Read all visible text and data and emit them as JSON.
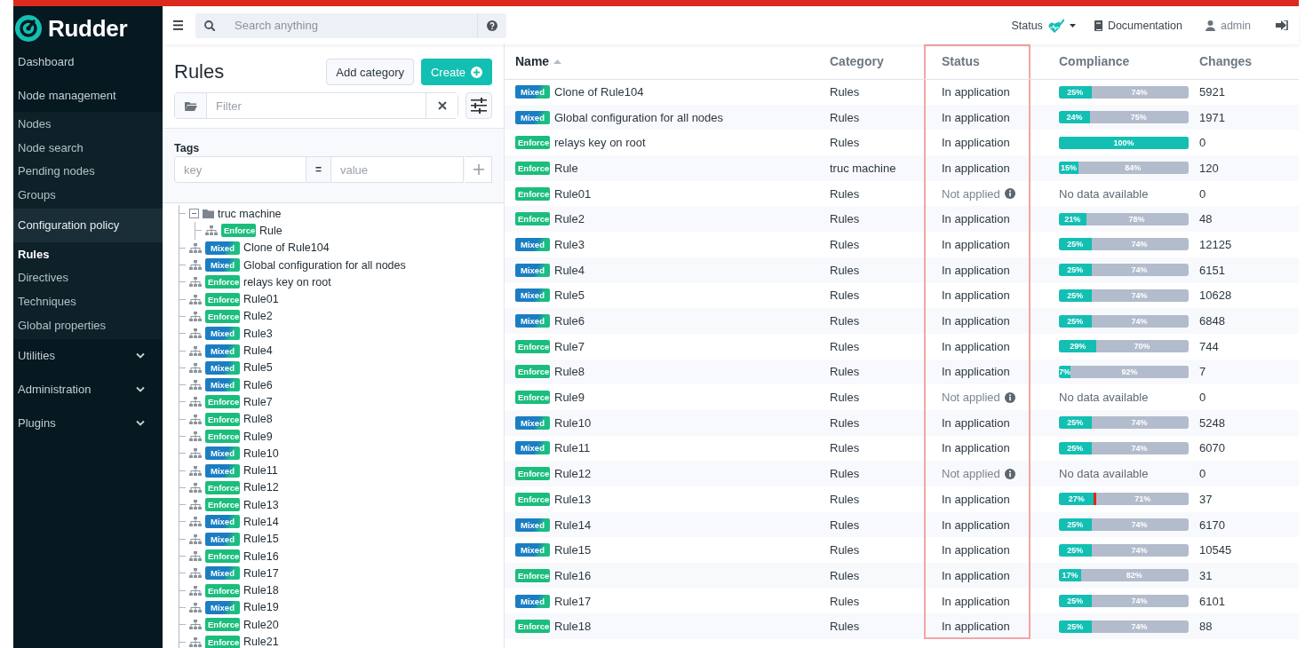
{
  "topbar": {
    "search": {
      "placeholder": "Search anything"
    },
    "status_label": "Status",
    "documentation": "Documentation",
    "user": "admin"
  },
  "sidebar": {
    "logo": "Rudder",
    "sections": [
      {
        "label": "Dashboard",
        "kind": "link",
        "selected": false
      },
      {
        "label": "Node management",
        "kind": "group",
        "selected": false,
        "expanded": true,
        "items": [
          {
            "label": "Nodes",
            "selected": false
          },
          {
            "label": "Node search",
            "selected": false
          },
          {
            "label": "Pending nodes",
            "selected": false
          },
          {
            "label": "Groups",
            "selected": false
          }
        ]
      },
      {
        "label": "Configuration policy",
        "kind": "group",
        "selected": true,
        "expanded": true,
        "items": [
          {
            "label": "Rules",
            "selected": true
          },
          {
            "label": "Directives",
            "selected": false
          },
          {
            "label": "Techniques",
            "selected": false
          },
          {
            "label": "Global properties",
            "selected": false
          }
        ]
      },
      {
        "label": "Utilities",
        "kind": "group",
        "selected": false,
        "expanded": false
      },
      {
        "label": "Administration",
        "kind": "group",
        "selected": false,
        "expanded": false
      },
      {
        "label": "Plugins",
        "kind": "group",
        "selected": false,
        "expanded": false
      }
    ]
  },
  "rules_panel": {
    "title": "Rules",
    "add_category": "Add category",
    "create": "Create",
    "filter": {
      "placeholder": "Filter"
    },
    "tags": {
      "label": "Tags",
      "key_placeholder": "key",
      "operator": "=",
      "value_placeholder": "value"
    },
    "tree": [
      {
        "kind": "folder",
        "label": "truc machine",
        "expanded": true,
        "children": [
          {
            "kind": "rule",
            "mode": {
              "kind": "enforce",
              "label": "Enforce"
            },
            "label": "Rule"
          }
        ]
      },
      {
        "kind": "rule",
        "mode": {
          "kind": "mixed",
          "label": "Mixed"
        },
        "label": "Clone of Rule104"
      },
      {
        "kind": "rule",
        "mode": {
          "kind": "mixed",
          "label": "Mixed"
        },
        "label": "Global configuration for all nodes"
      },
      {
        "kind": "rule",
        "mode": {
          "kind": "enforce",
          "label": "Enforce"
        },
        "label": "relays key on root"
      },
      {
        "kind": "rule",
        "mode": {
          "kind": "enforce",
          "label": "Enforce"
        },
        "label": "Rule01"
      },
      {
        "kind": "rule",
        "mode": {
          "kind": "enforce",
          "label": "Enforce"
        },
        "label": "Rule2"
      },
      {
        "kind": "rule",
        "mode": {
          "kind": "mixed",
          "label": "Mixed"
        },
        "label": "Rule3"
      },
      {
        "kind": "rule",
        "mode": {
          "kind": "mixed",
          "label": "Mixed"
        },
        "label": "Rule4"
      },
      {
        "kind": "rule",
        "mode": {
          "kind": "mixed",
          "label": "Mixed"
        },
        "label": "Rule5"
      },
      {
        "kind": "rule",
        "mode": {
          "kind": "mixed",
          "label": "Mixed"
        },
        "label": "Rule6"
      },
      {
        "kind": "rule",
        "mode": {
          "kind": "enforce",
          "label": "Enforce"
        },
        "label": "Rule7"
      },
      {
        "kind": "rule",
        "mode": {
          "kind": "enforce",
          "label": "Enforce"
        },
        "label": "Rule8"
      },
      {
        "kind": "rule",
        "mode": {
          "kind": "enforce",
          "label": "Enforce"
        },
        "label": "Rule9"
      },
      {
        "kind": "rule",
        "mode": {
          "kind": "mixed",
          "label": "Mixed"
        },
        "label": "Rule10"
      },
      {
        "kind": "rule",
        "mode": {
          "kind": "mixed",
          "label": "Mixed"
        },
        "label": "Rule11"
      },
      {
        "kind": "rule",
        "mode": {
          "kind": "enforce",
          "label": "Enforce"
        },
        "label": "Rule12"
      },
      {
        "kind": "rule",
        "mode": {
          "kind": "enforce",
          "label": "Enforce"
        },
        "label": "Rule13"
      },
      {
        "kind": "rule",
        "mode": {
          "kind": "mixed",
          "label": "Mixed"
        },
        "label": "Rule14"
      },
      {
        "kind": "rule",
        "mode": {
          "kind": "mixed",
          "label": "Mixed"
        },
        "label": "Rule15"
      },
      {
        "kind": "rule",
        "mode": {
          "kind": "enforce",
          "label": "Enforce"
        },
        "label": "Rule16"
      },
      {
        "kind": "rule",
        "mode": {
          "kind": "mixed",
          "label": "Mixed"
        },
        "label": "Rule17"
      },
      {
        "kind": "rule",
        "mode": {
          "kind": "enforce",
          "label": "Enforce"
        },
        "label": "Rule18"
      },
      {
        "kind": "rule",
        "mode": {
          "kind": "mixed",
          "label": "Mixed"
        },
        "label": "Rule19"
      },
      {
        "kind": "rule",
        "mode": {
          "kind": "enforce",
          "label": "Enforce"
        },
        "label": "Rule20"
      },
      {
        "kind": "rule",
        "mode": {
          "kind": "enforce",
          "label": "Enforce"
        },
        "label": "Rule21"
      }
    ]
  },
  "table": {
    "columns": [
      {
        "label": "Name",
        "sorted": true
      },
      {
        "label": "Category",
        "sorted": false
      },
      {
        "label": "Status",
        "sorted": false
      },
      {
        "label": "Compliance",
        "sorted": false
      },
      {
        "label": "Changes",
        "sorted": false
      }
    ],
    "rows": [
      {
        "mode": {
          "kind": "mixed",
          "label": "Mixed"
        },
        "name": "Clone of Rule104",
        "category": "Rules",
        "status": {
          "kind": "applied",
          "text": "In application"
        },
        "compliance": {
          "kind": "bar",
          "segments": [
            {
              "kind": "success",
              "label": "25%",
              "level": 0.25
            },
            {
              "kind": "pending",
              "label": "74%",
              "level": 0.74
            }
          ]
        },
        "changes": "5921"
      },
      {
        "mode": {
          "kind": "mixed",
          "label": "Mixed"
        },
        "name": "Global configuration for all nodes",
        "category": "Rules",
        "status": {
          "kind": "applied",
          "text": "In application"
        },
        "compliance": {
          "kind": "bar",
          "segments": [
            {
              "kind": "success",
              "label": "24%",
              "level": 0.24
            },
            {
              "kind": "pending",
              "label": "75%",
              "level": 0.75
            }
          ]
        },
        "changes": "1971"
      },
      {
        "mode": {
          "kind": "enforce",
          "label": "Enforce"
        },
        "name": "relays key on root",
        "category": "Rules",
        "status": {
          "kind": "applied",
          "text": "In application"
        },
        "compliance": {
          "kind": "bar",
          "segments": [
            {
              "kind": "success",
              "label": "100%",
              "level": 1
            }
          ]
        },
        "changes": "0"
      },
      {
        "mode": {
          "kind": "enforce",
          "label": "Enforce"
        },
        "name": "Rule",
        "category": "truc machine",
        "status": {
          "kind": "applied",
          "text": "In application"
        },
        "compliance": {
          "kind": "bar",
          "segments": [
            {
              "kind": "success",
              "label": "15%",
              "level": 0.15
            },
            {
              "kind": "pending",
              "label": "84%",
              "level": 0.84
            }
          ]
        },
        "changes": "120"
      },
      {
        "mode": {
          "kind": "enforce",
          "label": "Enforce"
        },
        "name": "Rule01",
        "category": "Rules",
        "status": {
          "kind": "not_applied",
          "text": "Not applied"
        },
        "compliance": {
          "kind": "none",
          "text": "No data available"
        },
        "changes": "0"
      },
      {
        "mode": {
          "kind": "enforce",
          "label": "Enforce"
        },
        "name": "Rule2",
        "category": "Rules",
        "status": {
          "kind": "applied",
          "text": "In application"
        },
        "compliance": {
          "kind": "bar",
          "segments": [
            {
              "kind": "success",
              "label": "21%",
              "level": 0.21
            },
            {
              "kind": "pending",
              "label": "78%",
              "level": 0.78
            }
          ]
        },
        "changes": "48"
      },
      {
        "mode": {
          "kind": "mixed",
          "label": "Mixed"
        },
        "name": "Rule3",
        "category": "Rules",
        "status": {
          "kind": "applied",
          "text": "In application"
        },
        "compliance": {
          "kind": "bar",
          "segments": [
            {
              "kind": "success",
              "label": "25%",
              "level": 0.25
            },
            {
              "kind": "pending",
              "label": "74%",
              "level": 0.74
            }
          ]
        },
        "changes": "12125"
      },
      {
        "mode": {
          "kind": "mixed",
          "label": "Mixed"
        },
        "name": "Rule4",
        "category": "Rules",
        "status": {
          "kind": "applied",
          "text": "In application"
        },
        "compliance": {
          "kind": "bar",
          "segments": [
            {
              "kind": "success",
              "label": "25%",
              "level": 0.25
            },
            {
              "kind": "pending",
              "label": "74%",
              "level": 0.74
            }
          ]
        },
        "changes": "6151"
      },
      {
        "mode": {
          "kind": "mixed",
          "label": "Mixed"
        },
        "name": "Rule5",
        "category": "Rules",
        "status": {
          "kind": "applied",
          "text": "In application"
        },
        "compliance": {
          "kind": "bar",
          "segments": [
            {
              "kind": "success",
              "label": "25%",
              "level": 0.25
            },
            {
              "kind": "pending",
              "label": "74%",
              "level": 0.74
            }
          ]
        },
        "changes": "10628"
      },
      {
        "mode": {
          "kind": "mixed",
          "label": "Mixed"
        },
        "name": "Rule6",
        "category": "Rules",
        "status": {
          "kind": "applied",
          "text": "In application"
        },
        "compliance": {
          "kind": "bar",
          "segments": [
            {
              "kind": "success",
              "label": "25%",
              "level": 0.25
            },
            {
              "kind": "pending",
              "label": "74%",
              "level": 0.74
            }
          ]
        },
        "changes": "6848"
      },
      {
        "mode": {
          "kind": "enforce",
          "label": "Enforce"
        },
        "name": "Rule7",
        "category": "Rules",
        "status": {
          "kind": "applied",
          "text": "In application"
        },
        "compliance": {
          "kind": "bar",
          "segments": [
            {
              "kind": "success",
              "label": "29%",
              "level": 0.29
            },
            {
              "kind": "pending",
              "label": "70%",
              "level": 0.7
            }
          ]
        },
        "changes": "744"
      },
      {
        "mode": {
          "kind": "enforce",
          "label": "Enforce"
        },
        "name": "Rule8",
        "category": "Rules",
        "status": {
          "kind": "applied",
          "text": "In application"
        },
        "compliance": {
          "kind": "bar",
          "segments": [
            {
              "kind": "success",
              "label": "7%",
              "level": 0.07
            },
            {
              "kind": "pending",
              "label": "92%",
              "level": 0.92
            }
          ]
        },
        "changes": "7"
      },
      {
        "mode": {
          "kind": "enforce",
          "label": "Enforce"
        },
        "name": "Rule9",
        "category": "Rules",
        "status": {
          "kind": "not_applied",
          "text": "Not applied"
        },
        "compliance": {
          "kind": "none",
          "text": "No data available"
        },
        "changes": "0"
      },
      {
        "mode": {
          "kind": "mixed",
          "label": "Mixed"
        },
        "name": "Rule10",
        "category": "Rules",
        "status": {
          "kind": "applied",
          "text": "In application"
        },
        "compliance": {
          "kind": "bar",
          "segments": [
            {
              "kind": "success",
              "label": "25%",
              "level": 0.25
            },
            {
              "kind": "pending",
              "label": "74%",
              "level": 0.74
            }
          ]
        },
        "changes": "5248"
      },
      {
        "mode": {
          "kind": "mixed",
          "label": "Mixed"
        },
        "name": "Rule11",
        "category": "Rules",
        "status": {
          "kind": "applied",
          "text": "In application"
        },
        "compliance": {
          "kind": "bar",
          "segments": [
            {
              "kind": "success",
              "label": "25%",
              "level": 0.25
            },
            {
              "kind": "pending",
              "label": "74%",
              "level": 0.74
            }
          ]
        },
        "changes": "6070"
      },
      {
        "mode": {
          "kind": "enforce",
          "label": "Enforce"
        },
        "name": "Rule12",
        "category": "Rules",
        "status": {
          "kind": "not_applied",
          "text": "Not applied"
        },
        "compliance": {
          "kind": "none",
          "text": "No data available"
        },
        "changes": "0"
      },
      {
        "mode": {
          "kind": "enforce",
          "label": "Enforce"
        },
        "name": "Rule13",
        "category": "Rules",
        "status": {
          "kind": "applied",
          "text": "In application"
        },
        "compliance": {
          "kind": "bar",
          "segments": [
            {
              "kind": "success",
              "label": "27%",
              "level": 0.27
            },
            {
              "kind": "error",
              "level": 0.02
            },
            {
              "kind": "pending",
              "label": "71%",
              "level": 0.71
            }
          ]
        },
        "changes": "37"
      },
      {
        "mode": {
          "kind": "mixed",
          "label": "Mixed"
        },
        "name": "Rule14",
        "category": "Rules",
        "status": {
          "kind": "applied",
          "text": "In application"
        },
        "compliance": {
          "kind": "bar",
          "segments": [
            {
              "kind": "success",
              "label": "25%",
              "level": 0.25
            },
            {
              "kind": "pending",
              "label": "74%",
              "level": 0.74
            }
          ]
        },
        "changes": "6170"
      },
      {
        "mode": {
          "kind": "mixed",
          "label": "Mixed"
        },
        "name": "Rule15",
        "category": "Rules",
        "status": {
          "kind": "applied",
          "text": "In application"
        },
        "compliance": {
          "kind": "bar",
          "segments": [
            {
              "kind": "success",
              "label": "25%",
              "level": 0.25
            },
            {
              "kind": "pending",
              "label": "74%",
              "level": 0.74
            }
          ]
        },
        "changes": "10545"
      },
      {
        "mode": {
          "kind": "enforce",
          "label": "Enforce"
        },
        "name": "Rule16",
        "category": "Rules",
        "status": {
          "kind": "applied",
          "text": "In application"
        },
        "compliance": {
          "kind": "bar",
          "segments": [
            {
              "kind": "success",
              "label": "17%",
              "level": 0.17
            },
            {
              "kind": "pending",
              "label": "82%",
              "level": 0.82
            }
          ]
        },
        "changes": "31"
      },
      {
        "mode": {
          "kind": "mixed",
          "label": "Mixed"
        },
        "name": "Rule17",
        "category": "Rules",
        "status": {
          "kind": "applied",
          "text": "In application"
        },
        "compliance": {
          "kind": "bar",
          "segments": [
            {
              "kind": "success",
              "label": "25%",
              "level": 0.25
            },
            {
              "kind": "pending",
              "label": "74%",
              "level": 0.74
            }
          ]
        },
        "changes": "6101"
      },
      {
        "mode": {
          "kind": "enforce",
          "label": "Enforce"
        },
        "name": "Rule18",
        "category": "Rules",
        "status": {
          "kind": "applied",
          "text": "In application"
        },
        "compliance": {
          "kind": "bar",
          "segments": [
            {
              "kind": "success",
              "label": "25%",
              "level": 0.25
            },
            {
              "kind": "pending",
              "label": "74%",
              "level": 0.74
            }
          ]
        },
        "changes": "88"
      }
    ]
  }
}
